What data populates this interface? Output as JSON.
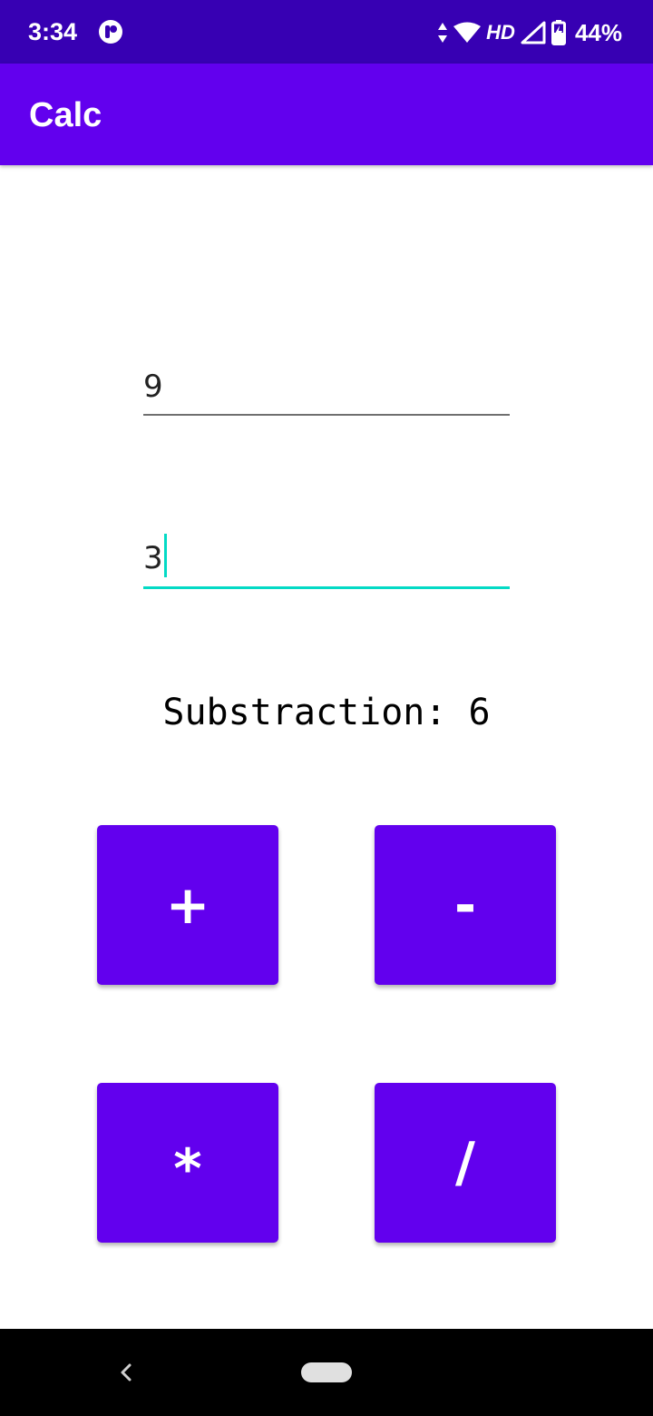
{
  "status_bar": {
    "time": "3:34",
    "network_label": "HD",
    "battery": "44%",
    "icons": [
      "app-notification-icon",
      "data-arrows-icon",
      "wifi-icon",
      "cell-signal-icon",
      "battery-charging-icon"
    ]
  },
  "app_bar": {
    "title": "Calc"
  },
  "inputs": {
    "first_value": "9",
    "second_value": "3"
  },
  "result": {
    "text": "Substraction: 6"
  },
  "buttons": {
    "add": "+",
    "subtract": "-",
    "multiply": "*",
    "divide": "/"
  },
  "colors": {
    "status_bar": "#3700b3",
    "primary": "#6200ee",
    "accent": "#03dac5"
  }
}
